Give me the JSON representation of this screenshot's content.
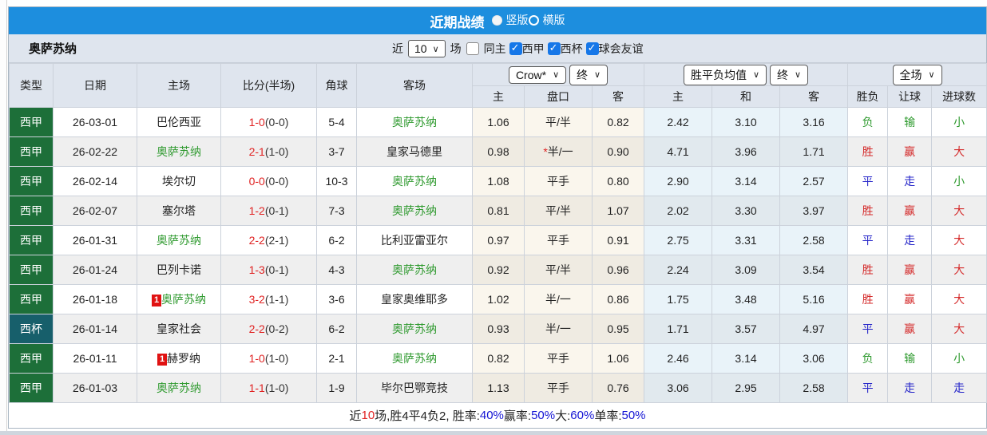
{
  "colors": {
    "accent_blue": "#1d8ede",
    "league_green": "#1d6f39",
    "cup_teal": "#175f6b",
    "team_highlight_green": "#2f9a2f",
    "score_red": "#e02222",
    "result_red": "#d42a2a",
    "result_blue": "#2626c9",
    "result_green": "#2f9a2f",
    "summary_blue": "#1414d4"
  },
  "header": {
    "title": "近期战绩",
    "layout_options": [
      {
        "label": "竖版",
        "selected": true
      },
      {
        "label": "横版",
        "selected": false
      }
    ]
  },
  "filter": {
    "team_name": "奥萨苏纳",
    "recent_prefix": "近",
    "recent_value": "10",
    "recent_suffix": "场",
    "checkboxes": [
      {
        "label": "同主",
        "checked": false
      },
      {
        "label": "西甲",
        "checked": true
      },
      {
        "label": "西杯",
        "checked": true
      },
      {
        "label": "球会友谊",
        "checked": true
      }
    ]
  },
  "table": {
    "static_headers": [
      "类型",
      "日期",
      "主场",
      "比分(半场)",
      "角球",
      "客场"
    ],
    "groups": [
      {
        "dropdowns": [
          "Crow*",
          "终"
        ],
        "sub": [
          "主",
          "盘口",
          "客"
        ]
      },
      {
        "dropdowns": [
          "胜平负均值",
          "终"
        ],
        "sub": [
          "主",
          "和",
          "客"
        ]
      },
      {
        "dropdowns": [
          "全场"
        ],
        "sub": [
          "胜负",
          "让球",
          "进球数"
        ]
      }
    ],
    "rows": [
      {
        "type": "西甲",
        "type_style": "league",
        "date": "26-03-01",
        "home": {
          "name": "巴伦西亚",
          "hl": false,
          "badge": null
        },
        "score": "1-0",
        "half": "(0-0)",
        "corner": "5-4",
        "away": {
          "name": "奥萨苏纳",
          "hl": true,
          "badge": null
        },
        "odds_home": "1.06",
        "handicap": "平/半",
        "odds_away": "0.82",
        "mean": [
          "2.42",
          "3.10",
          "3.16"
        ],
        "results": [
          {
            "text": "负",
            "color": "green"
          },
          {
            "text": "输",
            "color": "green"
          },
          {
            "text": "小",
            "color": "green"
          }
        ]
      },
      {
        "type": "西甲",
        "type_style": "league",
        "date": "26-02-22",
        "home": {
          "name": "奥萨苏纳",
          "hl": true,
          "badge": null
        },
        "score": "2-1",
        "half": "(1-0)",
        "corner": "3-7",
        "away": {
          "name": "皇家马德里",
          "hl": false,
          "badge": null
        },
        "odds_home": "0.98",
        "handicap": "*半/一",
        "odds_away": "0.90",
        "mean": [
          "4.71",
          "3.96",
          "1.71"
        ],
        "results": [
          {
            "text": "胜",
            "color": "red"
          },
          {
            "text": "赢",
            "color": "red"
          },
          {
            "text": "大",
            "color": "red"
          }
        ]
      },
      {
        "type": "西甲",
        "type_style": "league",
        "date": "26-02-14",
        "home": {
          "name": "埃尔切",
          "hl": false,
          "badge": null
        },
        "score": "0-0",
        "half": "(0-0)",
        "corner": "10-3",
        "away": {
          "name": "奥萨苏纳",
          "hl": true,
          "badge": null
        },
        "odds_home": "1.08",
        "handicap": "平手",
        "odds_away": "0.80",
        "mean": [
          "2.90",
          "3.14",
          "2.57"
        ],
        "results": [
          {
            "text": "平",
            "color": "blue"
          },
          {
            "text": "走",
            "color": "blue"
          },
          {
            "text": "小",
            "color": "green"
          }
        ]
      },
      {
        "type": "西甲",
        "type_style": "league",
        "date": "26-02-07",
        "home": {
          "name": "塞尔塔",
          "hl": false,
          "badge": null
        },
        "score": "1-2",
        "half": "(0-1)",
        "corner": "7-3",
        "away": {
          "name": "奥萨苏纳",
          "hl": true,
          "badge": null
        },
        "odds_home": "0.81",
        "handicap": "平/半",
        "odds_away": "1.07",
        "mean": [
          "2.02",
          "3.30",
          "3.97"
        ],
        "results": [
          {
            "text": "胜",
            "color": "red"
          },
          {
            "text": "赢",
            "color": "red"
          },
          {
            "text": "大",
            "color": "red"
          }
        ]
      },
      {
        "type": "西甲",
        "type_style": "league",
        "date": "26-01-31",
        "home": {
          "name": "奥萨苏纳",
          "hl": true,
          "badge": null
        },
        "score": "2-2",
        "half": "(2-1)",
        "corner": "6-2",
        "away": {
          "name": "比利亚雷亚尔",
          "hl": false,
          "badge": null
        },
        "odds_home": "0.97",
        "handicap": "平手",
        "odds_away": "0.91",
        "mean": [
          "2.75",
          "3.31",
          "2.58"
        ],
        "results": [
          {
            "text": "平",
            "color": "blue"
          },
          {
            "text": "走",
            "color": "blue"
          },
          {
            "text": "大",
            "color": "red"
          }
        ]
      },
      {
        "type": "西甲",
        "type_style": "league",
        "date": "26-01-24",
        "home": {
          "name": "巴列卡诺",
          "hl": false,
          "badge": null
        },
        "score": "1-3",
        "half": "(0-1)",
        "corner": "4-3",
        "away": {
          "name": "奥萨苏纳",
          "hl": true,
          "badge": null
        },
        "odds_home": "0.92",
        "handicap": "平/半",
        "odds_away": "0.96",
        "mean": [
          "2.24",
          "3.09",
          "3.54"
        ],
        "results": [
          {
            "text": "胜",
            "color": "red"
          },
          {
            "text": "赢",
            "color": "red"
          },
          {
            "text": "大",
            "color": "red"
          }
        ]
      },
      {
        "type": "西甲",
        "type_style": "league",
        "date": "26-01-18",
        "home": {
          "name": "奥萨苏纳",
          "hl": true,
          "badge": "1"
        },
        "score": "3-2",
        "half": "(1-1)",
        "corner": "3-6",
        "away": {
          "name": "皇家奥维耶多",
          "hl": false,
          "badge": null
        },
        "odds_home": "1.02",
        "handicap": "半/一",
        "odds_away": "0.86",
        "mean": [
          "1.75",
          "3.48",
          "5.16"
        ],
        "results": [
          {
            "text": "胜",
            "color": "red"
          },
          {
            "text": "赢",
            "color": "red"
          },
          {
            "text": "大",
            "color": "red"
          }
        ]
      },
      {
        "type": "西杯",
        "type_style": "cup",
        "date": "26-01-14",
        "home": {
          "name": "皇家社会",
          "hl": false,
          "badge": null
        },
        "score": "2-2",
        "half": "(0-2)",
        "corner": "6-2",
        "away": {
          "name": "奥萨苏纳",
          "hl": true,
          "badge": null
        },
        "odds_home": "0.93",
        "handicap": "半/一",
        "odds_away": "0.95",
        "mean": [
          "1.71",
          "3.57",
          "4.97"
        ],
        "results": [
          {
            "text": "平",
            "color": "blue"
          },
          {
            "text": "赢",
            "color": "red"
          },
          {
            "text": "大",
            "color": "red"
          }
        ]
      },
      {
        "type": "西甲",
        "type_style": "league",
        "date": "26-01-11",
        "home": {
          "name": "赫罗纳",
          "hl": false,
          "badge": "1"
        },
        "score": "1-0",
        "half": "(1-0)",
        "corner": "2-1",
        "away": {
          "name": "奥萨苏纳",
          "hl": true,
          "badge": null
        },
        "odds_home": "0.82",
        "handicap": "平手",
        "odds_away": "1.06",
        "mean": [
          "2.46",
          "3.14",
          "3.06"
        ],
        "results": [
          {
            "text": "负",
            "color": "green"
          },
          {
            "text": "输",
            "color": "green"
          },
          {
            "text": "小",
            "color": "green"
          }
        ]
      },
      {
        "type": "西甲",
        "type_style": "league",
        "date": "26-01-03",
        "home": {
          "name": "奥萨苏纳",
          "hl": true,
          "badge": null
        },
        "score": "1-1",
        "half": "(1-0)",
        "corner": "1-9",
        "away": {
          "name": "毕尔巴鄂竞技",
          "hl": false,
          "badge": null
        },
        "odds_home": "1.13",
        "handicap": "平手",
        "odds_away": "0.76",
        "mean": [
          "3.06",
          "2.95",
          "2.58"
        ],
        "results": [
          {
            "text": "平",
            "color": "blue"
          },
          {
            "text": "走",
            "color": "blue"
          },
          {
            "text": "走",
            "color": "blue"
          }
        ]
      }
    ]
  },
  "summary": {
    "segments": [
      {
        "text": "近",
        "color": "black"
      },
      {
        "text": "10",
        "color": "red"
      },
      {
        "text": "场,胜4平4负2, 胜率:",
        "color": "black"
      },
      {
        "text": "40%",
        "color": "blue"
      },
      {
        "text": " 赢率:",
        "color": "black"
      },
      {
        "text": "50%",
        "color": "blue"
      },
      {
        "text": " 大:",
        "color": "black"
      },
      {
        "text": "60%",
        "color": "blue"
      },
      {
        "text": " 单率:",
        "color": "black"
      },
      {
        "text": "50%",
        "color": "blue"
      }
    ]
  }
}
